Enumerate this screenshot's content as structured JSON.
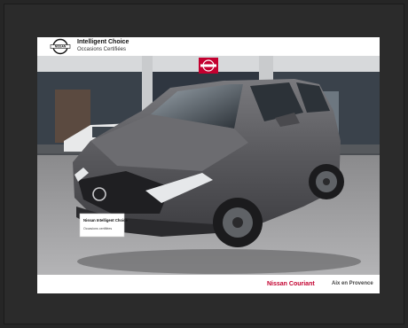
{
  "header": {
    "brand_title": "Intelligent Choice",
    "brand_subtitle": "Occasions Certifiées",
    "logo_text": "NISSAN"
  },
  "plate": {
    "line1": "Nissan Intelligent Choice",
    "line2": "Occasions certifiées"
  },
  "footer": {
    "dealer_name": "Nissan Couriant",
    "city": "Aix en Provence"
  },
  "colors": {
    "brand_red": "#c3002f",
    "frame": "#2b2b2b",
    "car_body": "#5b5b5f"
  }
}
